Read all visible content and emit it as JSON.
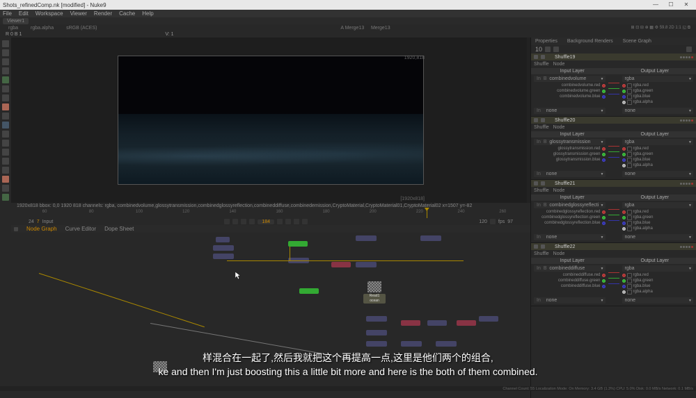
{
  "window": {
    "title": "Shots_refinedComp.nk [modified] - Nuke9",
    "min": "—",
    "max": "☐",
    "close": "✕"
  },
  "menu": [
    "File",
    "Edit",
    "Workspace",
    "Viewer",
    "Render",
    "Cache",
    "Help"
  ],
  "viewer_tab": "Viewer1",
  "channels": {
    "left": [
      "rgba",
      "rgba.alpha"
    ],
    "colorspace": "sRGB (ACES)",
    "center_a": "A  Merge13",
    "center_b": "Merge13",
    "right": "⊕  ⚙"
  },
  "toolbar_row": {
    "left": "R 0   B 1",
    "val": "V: 1"
  },
  "frame_res_tr": "1920,818",
  "frame_res_br": "[1920x818]",
  "info_bar": "1920x818   bbox: 0,0 1920 818 channels: rgba, combinedvolume,glossytransmission,combinedglossyreflection,combineddiffuse,combinedemission,CryptoMaterial,CryptoMaterial01,CryptoMaterial02        x=1507 y=-82",
  "timeline": {
    "frames": [
      "60",
      "80",
      "100",
      "120",
      "140",
      "160",
      "180",
      "200",
      "220",
      "240",
      "260"
    ],
    "start": "24",
    "fps_l": "7",
    "input": "Input",
    "current": "184",
    "marker_end": "120",
    "fps_label": "fps",
    "end_label": "97"
  },
  "panel_tabs": [
    "Node Graph",
    "Curve Editor",
    "Dope Sheet"
  ],
  "right": {
    "tabs": [
      "Properties",
      "Background Renders",
      "Scene Graph"
    ],
    "count": "10",
    "shuffles": [
      {
        "title": "Shuffle19",
        "type": "Shuffle",
        "mode": "Node",
        "input_layer_hdr": "Input Layer",
        "output_layer_hdr": "Output Layer",
        "input_layer": "combinedvolume",
        "output_layer": "rgba",
        "left_rows": [
          "combinedvolume.red",
          "combinedvolume.green",
          "combinedvolume.blue"
        ],
        "right_rows": [
          "rgba.red",
          "rgba.green",
          "rgba.blue",
          "rgba.alpha"
        ],
        "none_l": "none",
        "none_r": "none"
      },
      {
        "title": "Shuffle20",
        "type": "Shuffle",
        "mode": "Node",
        "input_layer_hdr": "Input Layer",
        "output_layer_hdr": "Output Layer",
        "input_layer": "glossytransmission",
        "output_layer": "rgba",
        "left_rows": [
          "glossytransmission.red",
          "glossytransmission.green",
          "glossytransmission.blue"
        ],
        "right_rows": [
          "rgba.red",
          "rgba.green",
          "rgba.blue",
          "rgba.alpha"
        ],
        "none_l": "none",
        "none_r": "none"
      },
      {
        "title": "Shuffle21",
        "type": "Shuffle",
        "mode": "Node",
        "input_layer_hdr": "Input Layer",
        "output_layer_hdr": "Output Layer",
        "input_layer": "combinedglossyreflecti",
        "output_layer": "rgba",
        "left_rows": [
          "combinedglossyreflection.red",
          "combinedglossyreflection.green",
          "combinedglossyreflection.blue"
        ],
        "right_rows": [
          "rgba.red",
          "rgba.green",
          "rgba.blue",
          "rgba.alpha"
        ],
        "none_l": "none",
        "none_r": "none"
      },
      {
        "title": "Shuffle22",
        "type": "Shuffle",
        "mode": "Node",
        "input_layer_hdr": "Input Layer",
        "output_layer_hdr": "Output Layer",
        "input_layer": "combineddiffuse",
        "output_layer": "rgba",
        "left_rows": [
          "combineddiffuse.red",
          "combineddiffuse.green",
          "combineddiffuse.blue"
        ],
        "right_rows": [
          "rgba.red",
          "rgba.green",
          "rgba.blue",
          "rgba.alpha"
        ],
        "none_l": "none",
        "none_r": "none"
      }
    ],
    "label_in": "In",
    "checkbox_b": "B"
  },
  "status": {
    "left": "Channel Count: 55 Localization Mode: On  Memory: 3.4 GB (1.3%)  CPU: 5.0%  Disk: 0.0 MB/s  Network: 0.1 MB/s",
    "right": ""
  },
  "subtitles": {
    "cn": "样混合在一起了,然后我就把这个再提高一点,这里是他们两个的组合,",
    "en": "ke and then I'm just boosting this a little bit more and here is the both of them combined."
  },
  "accents": {
    "orange": "#c58a2a"
  }
}
